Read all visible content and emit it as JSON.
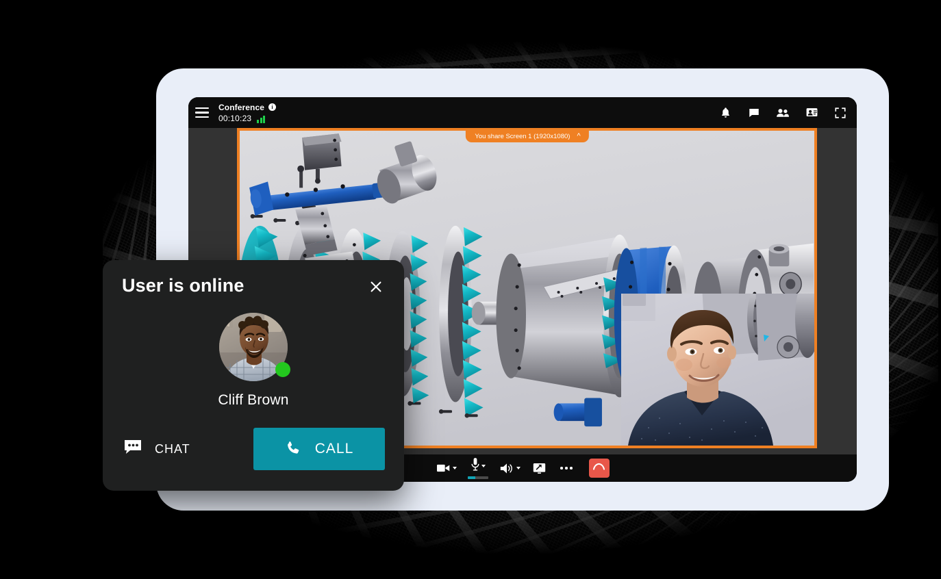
{
  "app": {
    "meeting_title": "Conference",
    "info_icon": "info-icon",
    "info_glyph": "i",
    "timer": "00:10:23",
    "menu_icon": "hamburger-menu-icon",
    "signal_icon": "signal-strength-icon"
  },
  "topbar_actions": [
    {
      "name": "notifications-bell-icon",
      "label": "Notifications"
    },
    {
      "name": "chat-icon",
      "label": "Chat"
    },
    {
      "name": "participants-icon",
      "label": "Participants"
    },
    {
      "name": "share-screen-icon",
      "label": "Share screen"
    },
    {
      "name": "fullscreen-icon",
      "label": "Fullscreen"
    }
  ],
  "share": {
    "banner_prefix": "You share",
    "banner_source": "Screen 1 (1920x1080)",
    "banner_text": "You share  Screen 1 (1920x1080)",
    "collapse_icon": "chevron-up-icon",
    "accent_color": "#ef8023",
    "canvas_color": "#d3d4d8",
    "content_description": "Exploded 3D CAD view of a gas turbine engine"
  },
  "selfview": {
    "name": "self-view-video",
    "description": "Local camera video of a smiling man in a dark navy shirt"
  },
  "controls": [
    {
      "name": "camera-button",
      "icon": "video-camera-icon",
      "has_caret": true
    },
    {
      "name": "microphone-button",
      "icon": "microphone-icon",
      "has_caret": true,
      "level_percent": 35
    },
    {
      "name": "speaker-button",
      "icon": "speaker-icon",
      "has_caret": true
    },
    {
      "name": "present-screen-button",
      "icon": "present-screen-icon",
      "has_caret": false
    },
    {
      "name": "more-options-button",
      "icon": "more-horizontal-icon",
      "has_caret": false
    },
    {
      "name": "hangup-button",
      "icon": "phone-hangup-icon",
      "color": "#e8574a"
    }
  ],
  "dialog": {
    "title": "User is online",
    "close_icon": "close-icon",
    "user_name": "Cliff Brown",
    "presence": "online",
    "presence_color": "#23c81e",
    "chat_label": "CHAT",
    "chat_icon": "chat-bubble-icon",
    "call_label": "CALL",
    "call_icon": "phone-icon",
    "call_color": "#0b93a5",
    "background_color": "#1f2020"
  },
  "device": {
    "bezel_color": "#e9eef8",
    "screen_color": "#0d0d0d",
    "stage_color": "#333333",
    "page_background": "#000000"
  }
}
